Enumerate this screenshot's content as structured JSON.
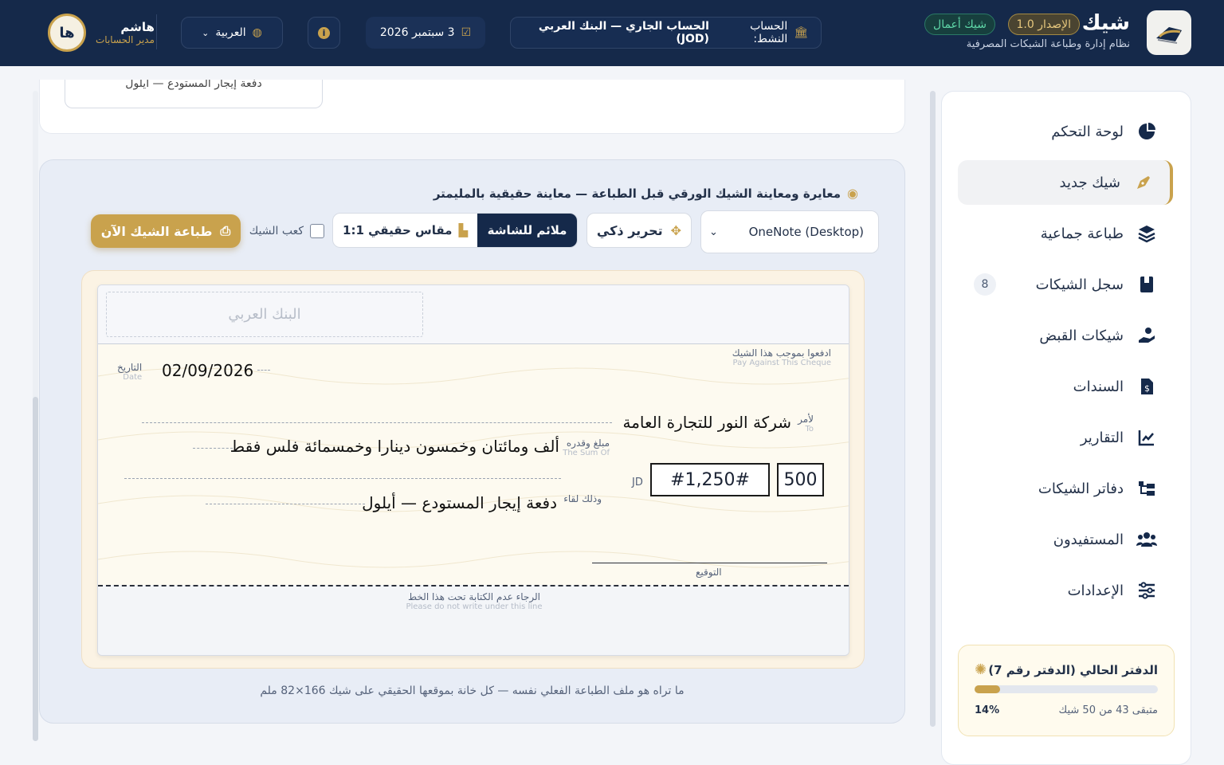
{
  "header": {
    "brand_name": "شيك",
    "brand_sub": "نظام إدارة وطباعة الشيكات المصرفية",
    "version": "الإصدار 1.0",
    "edition": "شيك أعمال",
    "account_label": "الحساب النشط:",
    "account_value": "الحساب الجاري — البنك العربي (JOD)",
    "date": "3 سبتمبر 2026",
    "language": "العربية",
    "user_name": "هاشم",
    "user_role": "مدير الحسابات",
    "user_initials": "ها"
  },
  "sidebar": {
    "items": [
      {
        "label": "لوحة التحكم",
        "icon": "pie-chart-icon"
      },
      {
        "label": "شيك جديد",
        "icon": "pen-nib-icon",
        "active": true
      },
      {
        "label": "طباعة جماعية",
        "icon": "layers-icon"
      },
      {
        "label": "سجل الشيكات",
        "icon": "book-icon",
        "count": "8"
      },
      {
        "label": "شيكات القبض",
        "icon": "hand-coin-icon"
      },
      {
        "label": "السندات",
        "icon": "invoice-icon"
      },
      {
        "label": "التقارير",
        "icon": "line-chart-icon"
      },
      {
        "label": "دفاتر الشيكات",
        "icon": "folder-tree-icon"
      },
      {
        "label": "المستفيدون",
        "icon": "users-icon"
      },
      {
        "label": "الإعدادات",
        "icon": "sliders-icon"
      }
    ],
    "current_book": {
      "title": "الدفتر الحالي (الدفتر رقم 7)",
      "remaining": "متبقى 43 من 50 شيك",
      "percent": "14%",
      "progress": 0.14
    }
  },
  "top_card": {
    "memo_field": "دفعة إيجار المستودع — أيلول"
  },
  "preview": {
    "title": "معايرة ومعاينة الشيك الورقي قبل الطباعة — معاينة حقيقية بالمليمتر",
    "printer": "OneNote (Desktop)",
    "smart_edit": "تحرير ذكي",
    "fit_screen": "ملائم للشاشة",
    "real_scale": "مقاس حقيقي 1:1",
    "stub_checkbox": "كعب الشيك",
    "print_now": "طباعة الشيك الآن",
    "footer_note": "ما تراه هو ملف الطباعة الفعلي نفسه — كل خانة بموقعها الحقيقي على شيك 166×82 ملم"
  },
  "cheque": {
    "bank_placeholder": "البنك العربي",
    "pay_against_ar": "ادفعوا بموجب هذا الشيك",
    "pay_against_en": "Pay Against This Cheque",
    "date_label_ar": "التاريخ",
    "date_label_en": "Date",
    "date_value": "02/09/2026",
    "to_label_ar": "لأمر",
    "to_label_en": "To",
    "payee": "شركة النور للتجارة العامة",
    "sum_label_ar": "مبلغ وقدره",
    "sum_label_en": "The Sum Of",
    "amount_words": "ألف ومائتان وخمسون دينارا وخمسمائة فلس فقط",
    "currency": "JD",
    "amount_main": "#1,250#",
    "amount_fils": "500",
    "memo_label_ar": "وذلك لقاء",
    "memo_value": "دفعة إيجار المستودع — أيلول",
    "signature_label": "التوقيع",
    "no_write_ar": "الرجاء عدم الكتابة تحت هذا الخط",
    "no_write_en": "Please do not write under this line"
  },
  "colors": {
    "navy": "#15294a",
    "gold": "#c9a24d",
    "green": "#5fd7a8"
  }
}
